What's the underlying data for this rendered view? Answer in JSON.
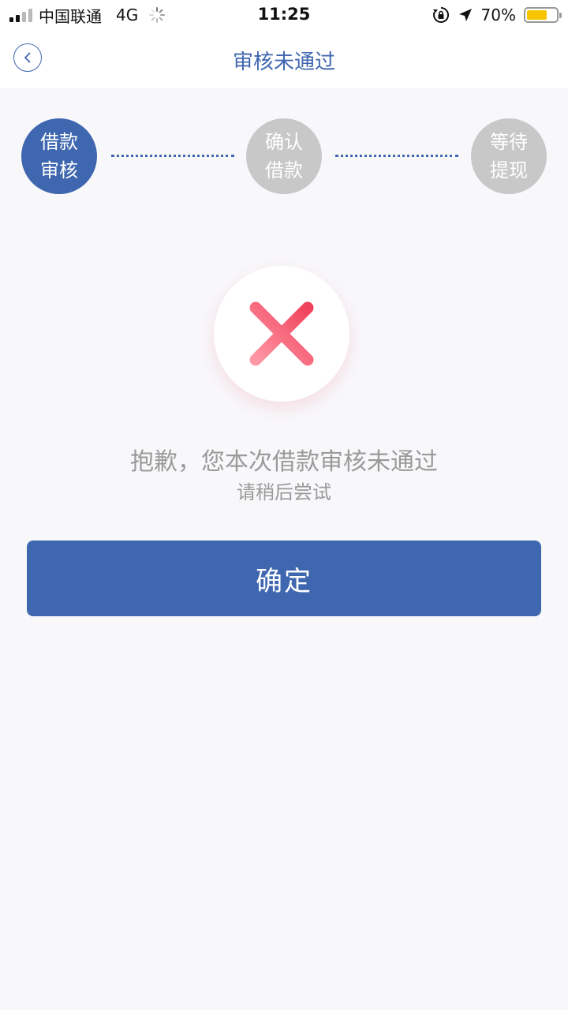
{
  "status_bar": {
    "carrier": "中国联通",
    "network": "4G",
    "time": "11:25",
    "battery_text": "70%",
    "battery_level": 0.7
  },
  "nav": {
    "title": "审核未通过",
    "back_icon": "chevron-left-icon"
  },
  "steps": [
    {
      "line1": "借款",
      "line2": "审核",
      "active": true
    },
    {
      "line1": "确认",
      "line2": "借款",
      "active": false
    },
    {
      "line1": "等待",
      "line2": "提现",
      "active": false
    }
  ],
  "result": {
    "icon": "close-icon",
    "message": "抱歉，您本次借款审核未通过",
    "sub_message": "请稍后尝试"
  },
  "confirm_button": {
    "label": "确定"
  },
  "colors": {
    "primary": "#3f67b0",
    "inactive_step": "#c8c8c8",
    "error_start": "#ff8a9a",
    "error_end": "#f0485f",
    "battery": "#f6c500",
    "text_muted": "#9a9a9a"
  }
}
